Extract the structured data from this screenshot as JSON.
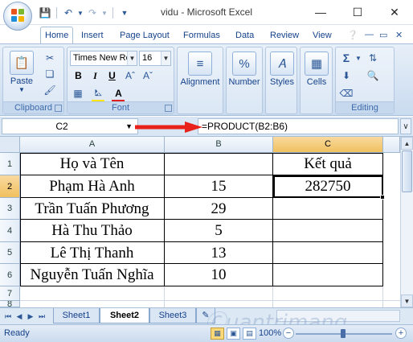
{
  "window": {
    "title": "vidu - Microsoft Excel",
    "minimize_glyph": "—",
    "maximize_glyph": "☐",
    "close_glyph": "✕"
  },
  "quick_access": {
    "save_icon": "save-icon",
    "undo_icon": "undo-icon",
    "redo_icon": "redo-icon",
    "customize_icon": "dropdown-icon"
  },
  "tabs": [
    "Home",
    "Insert",
    "Page Layout",
    "Formulas",
    "Data",
    "Review",
    "View"
  ],
  "active_tab": "Home",
  "ribbon": {
    "clipboard": {
      "label": "Clipboard",
      "paste_label": "Paste"
    },
    "font": {
      "label": "Font",
      "font_name": "Times New Ro",
      "font_size": "16",
      "bold": "B",
      "italic": "I",
      "underline": "U",
      "font_color_letter": "A"
    },
    "alignment": {
      "label": "Alignment"
    },
    "number": {
      "label": "Number",
      "icon_glyph": "%"
    },
    "styles": {
      "label": "Styles"
    },
    "cells": {
      "label": "Cells"
    },
    "editing": {
      "label": "Editing",
      "sum_glyph": "Σ"
    }
  },
  "formula_bar": {
    "name_box": "C2",
    "formula": "=PRODUCT(B2:B6)",
    "annotation_color": "#e8221b"
  },
  "columns": [
    "A",
    "B",
    "C"
  ],
  "selected_column": "C",
  "rows": [
    "1",
    "2",
    "3",
    "4",
    "5",
    "6",
    "7",
    "8"
  ],
  "selected_row": "2",
  "table": {
    "headers": [
      "Họ và Tên",
      "",
      "Kết quả"
    ],
    "rows": [
      [
        "Phạm Hà Anh",
        "15",
        "282750"
      ],
      [
        "Trần Tuấn Phương",
        "29",
        ""
      ],
      [
        "Hà Thu Thảo",
        "5",
        ""
      ],
      [
        "Lê Thị Thanh",
        "13",
        ""
      ],
      [
        "Nguyễn Tuấn Nghĩa",
        "10",
        ""
      ]
    ]
  },
  "sheets": [
    "Sheet1",
    "Sheet2",
    "Sheet3"
  ],
  "active_sheet": "Sheet2",
  "status": {
    "ready": "Ready",
    "zoom": "100%",
    "zoom_level": 1.0
  },
  "watermark": "Quantrimang",
  "colors": {
    "ribbon_bg": "#d5e3f3",
    "selection_header": "#f1c15f",
    "annotation_arrow": "#e8221b"
  }
}
